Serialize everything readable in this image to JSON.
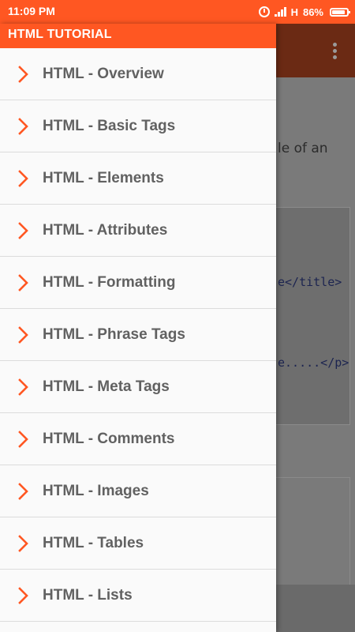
{
  "status_bar": {
    "time": "11:09 PM",
    "network": "H",
    "battery": "86%"
  },
  "drawer": {
    "title": "HTML TUTORIAL",
    "items": [
      {
        "label": "HTML - Overview"
      },
      {
        "label": "HTML - Basic Tags"
      },
      {
        "label": "HTML - Elements"
      },
      {
        "label": "HTML - Attributes"
      },
      {
        "label": "HTML - Formatting"
      },
      {
        "label": "HTML - Phrase Tags"
      },
      {
        "label": "HTML - Meta Tags"
      },
      {
        "label": "HTML - Comments"
      },
      {
        "label": "HTML - Images"
      },
      {
        "label": "HTML - Tables"
      },
      {
        "label": "HTML - Lists"
      }
    ]
  },
  "background": {
    "text_fragment": "le of an",
    "code_line_1": "e</title>",
    "code_line_2": "e.....</p>"
  },
  "colors": {
    "accent": "#ff5722",
    "item_text": "#616161",
    "chevron": "#ff5722",
    "drawer_bg": "#fafafa",
    "divider": "#dcdcdc"
  },
  "icons": {
    "status": [
      "alarm-icon",
      "signal-icon",
      "battery-icon"
    ],
    "item": "chevron-right-icon",
    "overflow": "more-vert-icon"
  }
}
